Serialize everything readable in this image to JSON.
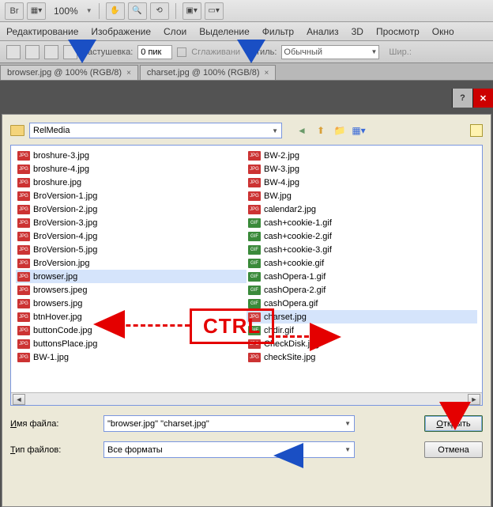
{
  "toolbar": {
    "br_label": "Br",
    "zoom": "100%"
  },
  "menu": {
    "items": [
      "Редактирование",
      "Изображение",
      "Слои",
      "Выделение",
      "Фильтр",
      "Анализ",
      "3D",
      "Просмотр",
      "Окно"
    ]
  },
  "options": {
    "feather_label": "Растушевка:",
    "feather_value": "0 пик",
    "antialias_label": "Сглаживани",
    "style_label": "Стиль:",
    "style_value": "Обычный",
    "width_label": "Шир.:"
  },
  "doc_tabs": [
    {
      "label": "browser.jpg @ 100% (RGB/8)"
    },
    {
      "label": "charset.jpg @ 100% (RGB/8)"
    }
  ],
  "dialog": {
    "folder": "RelMedia",
    "filename_label_a": "И",
    "filename_label_b": "мя файла:",
    "filetype_label_a": "Т",
    "filetype_label_b": "ип файлов:",
    "filename_value": "\"browser.jpg\" \"charset.jpg\"",
    "filetype_value": "Все форматы",
    "open_btn_a": "О",
    "open_btn_b": "ткрыть",
    "cancel_btn": "Отмена",
    "files_left": [
      {
        "name": "broshure-3.jpg",
        "type": "jpg"
      },
      {
        "name": "broshure-4.jpg",
        "type": "jpg"
      },
      {
        "name": "broshure.jpg",
        "type": "jpg"
      },
      {
        "name": "BroVersion-1.jpg",
        "type": "jpg"
      },
      {
        "name": "BroVersion-2.jpg",
        "type": "jpg"
      },
      {
        "name": "BroVersion-3.jpg",
        "type": "jpg"
      },
      {
        "name": "BroVersion-4.jpg",
        "type": "jpg"
      },
      {
        "name": "BroVersion-5.jpg",
        "type": "jpg"
      },
      {
        "name": "BroVersion.jpg",
        "type": "jpg"
      },
      {
        "name": "browser.jpg",
        "type": "jpg",
        "selected": true
      },
      {
        "name": "browsers.jpeg",
        "type": "jpg"
      },
      {
        "name": "browsers.jpg",
        "type": "jpg"
      },
      {
        "name": "btnHover.jpg",
        "type": "jpg"
      },
      {
        "name": "buttonCode.jpg",
        "type": "jpg"
      },
      {
        "name": "buttonsPlace.jpg",
        "type": "jpg"
      },
      {
        "name": "BW-1.jpg",
        "type": "jpg"
      }
    ],
    "files_right": [
      {
        "name": "BW-2.jpg",
        "type": "jpg"
      },
      {
        "name": "BW-3.jpg",
        "type": "jpg"
      },
      {
        "name": "BW-4.jpg",
        "type": "jpg"
      },
      {
        "name": "BW.jpg",
        "type": "jpg"
      },
      {
        "name": "calendar2.jpg",
        "type": "jpg"
      },
      {
        "name": "cash+cookie-1.gif",
        "type": "gif"
      },
      {
        "name": "cash+cookie-2.gif",
        "type": "gif"
      },
      {
        "name": "cash+cookie-3.gif",
        "type": "gif"
      },
      {
        "name": "cash+cookie.gif",
        "type": "gif"
      },
      {
        "name": "cashOpera-1.gif",
        "type": "gif"
      },
      {
        "name": "cashOpera-2.gif",
        "type": "gif"
      },
      {
        "name": "cashOpera.gif",
        "type": "gif"
      },
      {
        "name": "charset.jpg",
        "type": "jpg",
        "selected": true
      },
      {
        "name": "chdir.gif",
        "type": "gif"
      },
      {
        "name": "CheckDisk.jpg",
        "type": "jpg"
      },
      {
        "name": "checkSite.jpg",
        "type": "jpg"
      }
    ]
  },
  "annotation": {
    "ctrl_label": "CTRL"
  }
}
